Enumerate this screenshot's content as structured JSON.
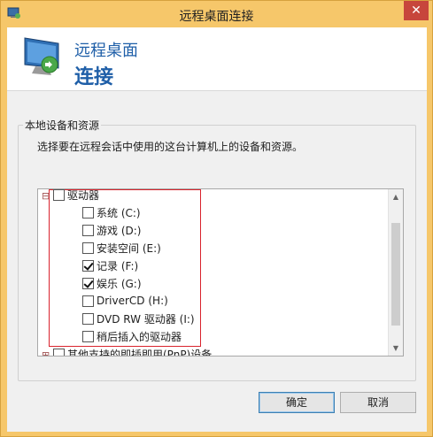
{
  "window": {
    "title": "远程桌面连接",
    "close_glyph": "✕"
  },
  "banner": {
    "line1": "远程桌面",
    "line2": "连接"
  },
  "group": {
    "label": "本地设备和资源",
    "description": "选择要在远程会话中使用的这台计算机上的设备和资源。"
  },
  "tree": {
    "parent": {
      "label": "驱动器",
      "checked": false,
      "expander": "⊟"
    },
    "items": [
      {
        "label": "系统 (C:)",
        "checked": false
      },
      {
        "label": "游戏 (D:)",
        "checked": false
      },
      {
        "label": "安装空间 (E:)",
        "checked": false
      },
      {
        "label": "记录 (F:)",
        "checked": true
      },
      {
        "label": "娱乐 (G:)",
        "checked": true
      },
      {
        "label": "DriverCD (H:)",
        "checked": false
      },
      {
        "label": "DVD RW 驱动器 (I:)",
        "checked": false
      },
      {
        "label": "稍后插入的驱动器",
        "checked": false
      }
    ],
    "next_parent": {
      "label": "其他支持的即插即用(PnP)设备",
      "checked": false,
      "expander": "⊞"
    }
  },
  "buttons": {
    "ok": "确定",
    "cancel": "取消"
  },
  "colors": {
    "titlebar": "#f6c76a",
    "accent_text": "#1f5fa8",
    "highlight_box": "#d9232d"
  }
}
